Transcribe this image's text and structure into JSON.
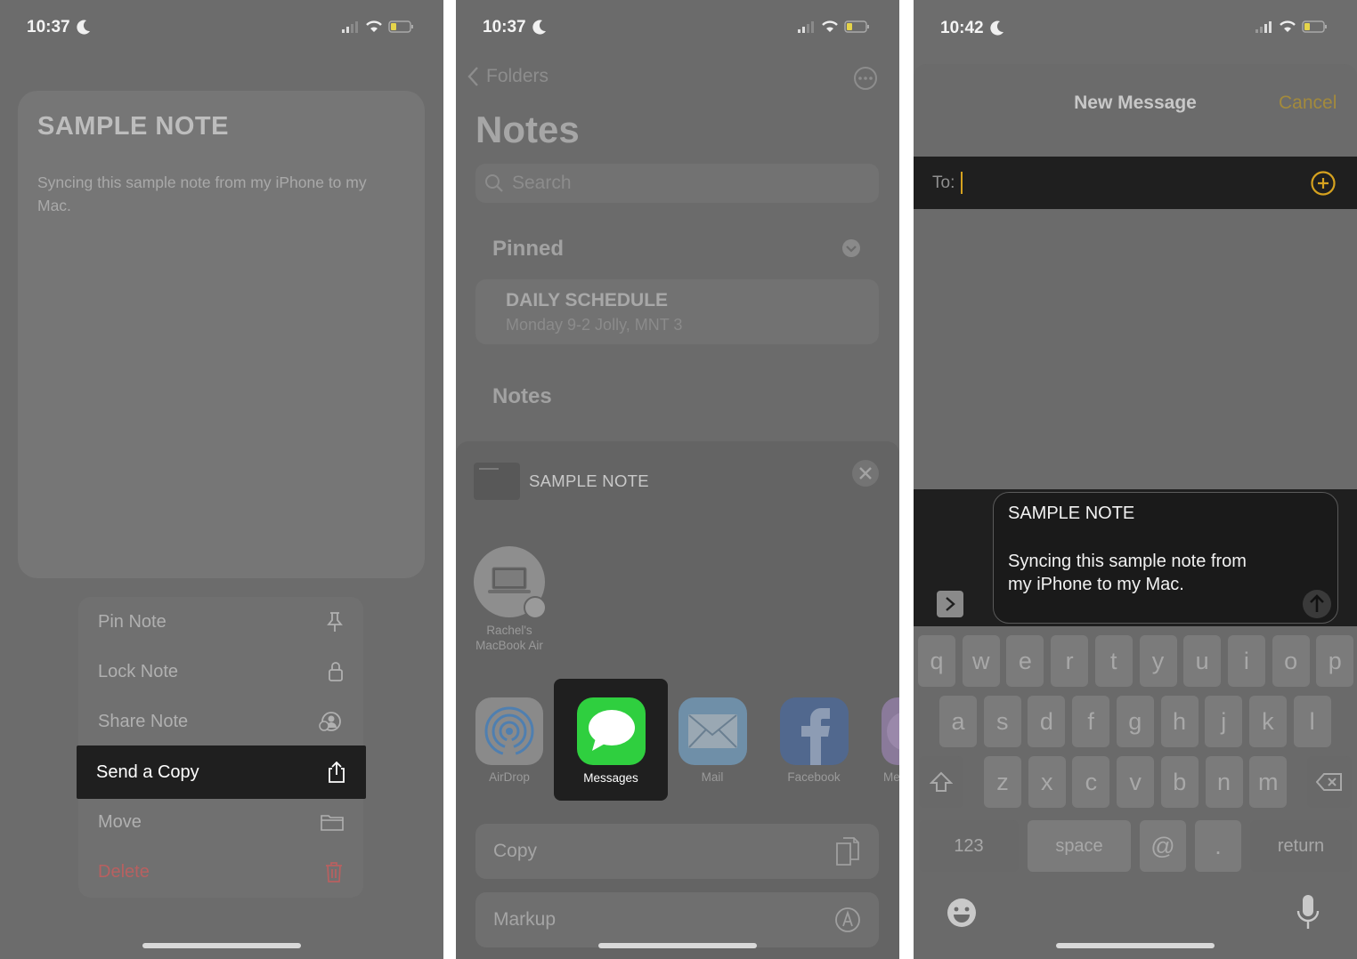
{
  "panel1": {
    "time": "10:37",
    "note": {
      "title": "SAMPLE NOTE",
      "body": "Syncing this sample note from my iPhone to my Mac."
    },
    "menu": [
      {
        "label": "Pin Note",
        "icon": "pin-icon"
      },
      {
        "label": "Lock Note",
        "icon": "lock-icon"
      },
      {
        "label": "Share Note",
        "icon": "share-person-icon"
      },
      {
        "label": "Send a Copy",
        "icon": "share-icon",
        "highlighted": true
      },
      {
        "label": "Move",
        "icon": "folder-icon"
      },
      {
        "label": "Delete",
        "icon": "trash-icon",
        "destructive": true
      }
    ]
  },
  "panel2": {
    "time": "10:37",
    "back_label": "Folders",
    "title": "Notes",
    "search_placeholder": "Search",
    "pinned_label": "Pinned",
    "pinned_note": {
      "title": "DAILY SCHEDULE",
      "preview": "Monday  9-2 Jolly, MNT 3"
    },
    "notes_label": "Notes",
    "share_sheet": {
      "title": "SAMPLE NOTE",
      "device_line1": "Rachel's",
      "device_line2": "MacBook Air",
      "apps": [
        {
          "label": "AirDrop",
          "icon": "airdrop-icon"
        },
        {
          "label": "Messages",
          "icon": "messages-icon",
          "highlighted": true
        },
        {
          "label": "Mail",
          "icon": "mail-icon"
        },
        {
          "label": "Facebook",
          "icon": "facebook-icon"
        },
        {
          "label": "Me",
          "icon": "app-icon"
        }
      ],
      "actions": [
        {
          "label": "Copy",
          "icon": "copy-icon"
        },
        {
          "label": "Markup",
          "icon": "markup-icon"
        }
      ]
    }
  },
  "panel3": {
    "time": "10:42",
    "header_title": "New Message",
    "cancel_label": "Cancel",
    "to_label": "To:",
    "message": {
      "title": "SAMPLE NOTE",
      "body_line1": "Syncing this sample note from",
      "body_line2": "my iPhone to my Mac."
    },
    "keyboard": {
      "row1": [
        "q",
        "w",
        "e",
        "r",
        "t",
        "y",
        "u",
        "i",
        "o",
        "p"
      ],
      "row2": [
        "a",
        "s",
        "d",
        "f",
        "g",
        "h",
        "j",
        "k",
        "l"
      ],
      "row3": [
        "z",
        "x",
        "c",
        "v",
        "b",
        "n",
        "m"
      ],
      "numbers_key": "123",
      "space_key": "space",
      "at_key": "@",
      "dot_key": ".",
      "return_key": "return"
    }
  },
  "colors": {
    "accent_yellow": "#d6a21f",
    "messages_green": "#2fcf3f",
    "delete_red": "#b86060"
  }
}
